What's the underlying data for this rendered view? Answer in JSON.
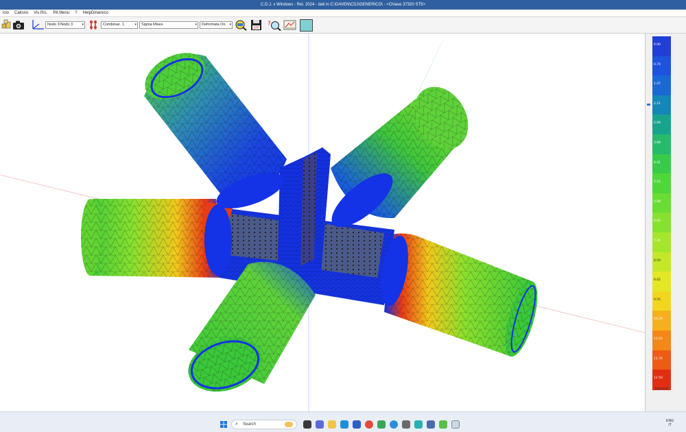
{
  "window": {
    "title": "C.D.J. x Windows - Rel. 2024 - dati in C:\\DAVEN\\CDJ\\GENERICO\\ - <Chiave 37320 ST5>"
  },
  "menu": {
    "items": [
      "icio",
      "Calcolo",
      "Vis.Ris.",
      "Rit.Menu",
      "?",
      "HelpDinamico"
    ]
  },
  "toolbar": {
    "node_select": "Nodo 3:Nodo 3",
    "combination_select": "Combinaz. 1",
    "stress_select": "Sigma Mises",
    "deform_select": "Deformata On"
  },
  "legend": {
    "values": [
      "0.00",
      "0.74",
      "1.47",
      "2.21",
      "2.94",
      "3.68",
      "4.41",
      "5.15",
      "5.88",
      "6.62",
      "7.35",
      "8.09",
      "8.82",
      "9.56",
      "10.29",
      "11.03",
      "11.76",
      "12.50"
    ],
    "colors": [
      "#1f3fd8",
      "#1e52e0",
      "#1a68d6",
      "#1586b8",
      "#17a48d",
      "#24bb6a",
      "#36cc4a",
      "#4fd73a",
      "#6add33",
      "#86e22e",
      "#a6e62a",
      "#c5e826",
      "#e3e822",
      "#f2d61e",
      "#f5b11b",
      "#f48718",
      "#ef5a15",
      "#e32d12"
    ],
    "unit": "[kg/cmq]"
  },
  "taskbar": {
    "search_placeholder": "Search",
    "tray_lang": "ENG",
    "tray_region": "IT"
  },
  "colors": {
    "titlebar": "#2f5f9e",
    "mesh_blue": "#1432e6",
    "mesh_green": "#62d432",
    "mesh_red": "#e3301a"
  }
}
